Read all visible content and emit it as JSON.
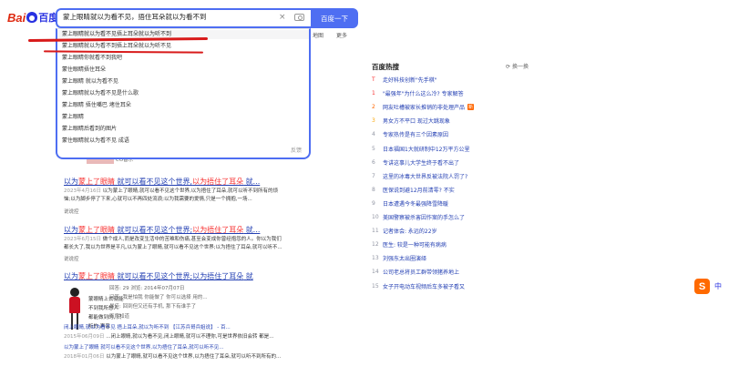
{
  "header": {
    "logo_left": "Bai",
    "logo_right": "百度",
    "search_value": "蒙上眼睛就以为看不见，捂住耳朵就以为看不到",
    "search_button": "百度一下",
    "clear_icon": "×"
  },
  "tabs": [
    "地图",
    "更多"
  ],
  "suggestions": {
    "items": [
      "蒙上眼睛就以为看不见捂上耳朵就以为听不到",
      "蒙上眼睛就以为看不到捂上耳朵就以为听不见",
      "蒙上眼睛你就看不到我吧",
      "蒙住眼睛捂住耳朵",
      "蒙上眼睛 就以为看不见",
      "蒙上眼睛就以为看不见是什么歌",
      "蒙上眼睛 捂住嘴巴 堵住耳朵",
      "蒙上眼睛",
      "蒙上眼睛后看到的图片",
      "蒙住眼睛就以为看不见 成语"
    ],
    "close_label": "反馈"
  },
  "results": [
    {
      "title_pre": "以为",
      "title_hl1": "蒙上了眼睛",
      "title_mid": " 就可以看不见这个世界,",
      "title_hl2": "以为捂住了耳朵",
      "title_post": " 就...",
      "date": "2023年4月16日",
      "snippet": "以为蒙上了眼睛,就可以看不见这个世界,以为捂住了耳朵,就可以听不到所有的烦恼;以为脚步停了下来,心就可以不再四处流浪;以为我需要的爱情,只是一个拥抱,一场...",
      "cache": "说说控"
    },
    {
      "title_pre": "以为",
      "title_hl1": "蒙上了眼睛",
      "title_mid": " 就可以看不见这个世界;",
      "title_hl2": "以为捂住了耳朵",
      "title_post": " 就...",
      "date": "2023年6月15日",
      "snippet": "做个成人,而是改变生活中的苦难和伤痛,甚至会变成你曾经抱怨的人。你以为我们都长大了,我以为世界是平凡,以为蒙上了眼睛,就可以看不见这个世界;以为捂住了耳朵,就可以听不...",
      "cache": "说说控"
    },
    {
      "title_pre": "以为",
      "title_hl1": "蒙上了眼睛",
      "title_mid": " 就可以看不见这个世界;以为捂住了耳朵",
      "title_hl2": "",
      "title_post": " 就",
      "img_lines": [
        "蒙眼睛上去就能",
        "不到我所想人",
        "都能做到的, 只",
        "听的 声音"
      ],
      "meta": [
        "回答: 29  浏览: 2014年07月07日",
        "问答: 我是怕我 你能做了 你可以选择 用的...",
        "最佳: 回到但又还有手机, 那下有谁手了"
      ],
      "meta_source": "百度知道",
      "extra1": "闭上眼睛,就以为看不见 捂上耳朵,就以为听不到 【江苏兵哥兵姐说】 - 百...",
      "extra1_date": "2015年06月09日",
      "extra1_snip": "...闭上眼睛,就以为看不见,闭上眼睛,就可以不理你,可是世界依旧会转 都是...",
      "extra2": "以为蒙上了眼睛 就可以看不见这个世界,以为捂住了耳朵,就可以听不见...",
      "extra2_date": "2018年01月06日",
      "extra2_snip": "以为蒙上了眼睛,就可以看不见这个世界,以为捂住了耳朵,就可以听不到所有的..."
    }
  ],
  "pink_sub": "CO音乐",
  "hot": {
    "title": "百度热搜",
    "refresh": "换一换",
    "items": [
      {
        "num": "T",
        "text": "走好科技创新\"先手棋\"",
        "badge": ""
      },
      {
        "num": "1",
        "text": "\"最强年\"为什么这么冷? 专家解答",
        "badge": ""
      },
      {
        "num": "2",
        "text": "网友吐槽被家长推销的非处理产品",
        "badge": "新"
      },
      {
        "num": "3",
        "text": "男女方不平口 现过大跳现象",
        "badge": ""
      },
      {
        "num": "4",
        "text": "专家热传是有三个因素原因",
        "badge": ""
      },
      {
        "num": "5",
        "text": "日本福国1大就研制中12万平方公里",
        "badge": ""
      },
      {
        "num": "6",
        "text": "专讲这事儿大学生终于看不出了",
        "badge": ""
      },
      {
        "num": "7",
        "text": "这里的冰毒大世界反被法院人罚了?",
        "badge": ""
      },
      {
        "num": "8",
        "text": "医保说到避12月前清零? 不实",
        "badge": ""
      },
      {
        "num": "9",
        "text": "日本遭遇今冬最强降雪降暖",
        "badge": ""
      },
      {
        "num": "10",
        "text": "美国警察被杀害因作案的手怎么了",
        "badge": ""
      },
      {
        "num": "11",
        "text": "记者体会: 永远的22岁",
        "badge": ""
      },
      {
        "num": "12",
        "text": "医生: 较是一种可能有病病",
        "badge": ""
      },
      {
        "num": "13",
        "text": "刘强东太出圈演绎",
        "badge": ""
      },
      {
        "num": "14",
        "text": "公司老总将员工群带领猪养地上",
        "badge": ""
      },
      {
        "num": "15",
        "text": "女子开电动车视频后车多被子看又",
        "badge": ""
      }
    ]
  },
  "ime": {
    "icon": "S",
    "lang": "中"
  },
  "colors": {
    "accent": "#4e6ef2",
    "highlight": "#f73131",
    "link": "#2440b3"
  }
}
